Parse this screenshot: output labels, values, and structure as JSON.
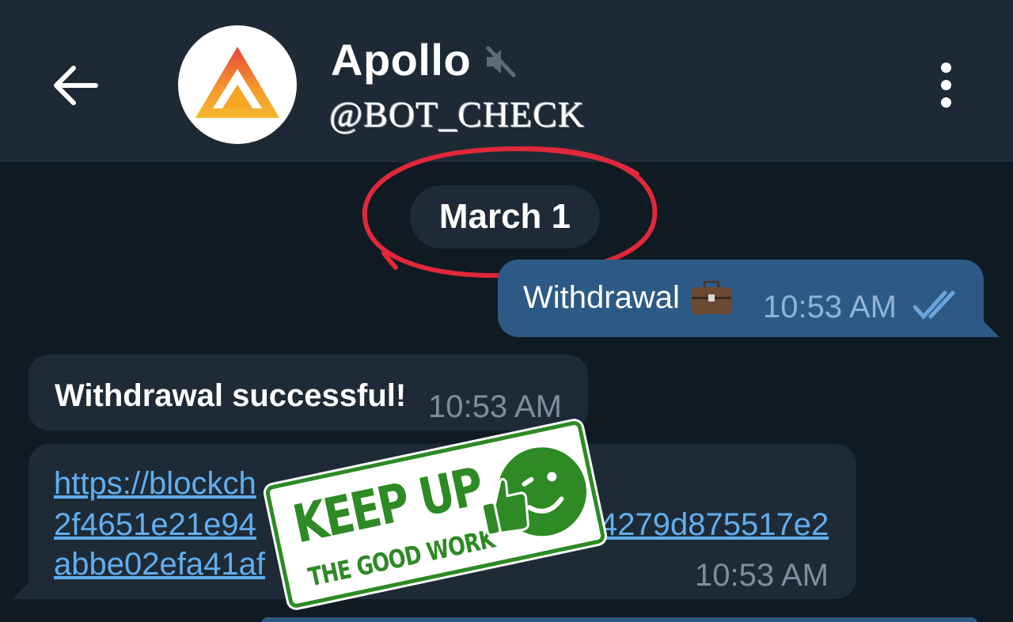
{
  "header": {
    "title": "Apollo",
    "subtitle": "@BOT_CHECK",
    "icons": [
      "back-arrow-icon",
      "bot-avatar-logo",
      "muted-speaker-icon",
      "more-vertical-icon"
    ]
  },
  "date_divider": {
    "label": "March 1"
  },
  "messages": {
    "outgoing": {
      "text": "Withdrawal",
      "emoji": "briefcase",
      "time": "10:53 AM",
      "status": "read"
    },
    "incoming_1": {
      "text": "Withdrawal successful!",
      "time": "10:53 AM"
    },
    "incoming_2": {
      "link_line_1": "https://blockch",
      "link_line_2": "2f4651e21e94",
      "link_line_2_end": "4279d875517e2",
      "link_line_3": "abbe02efa41af",
      "time": "10:53 AM"
    }
  },
  "sticker": {
    "line_1": "KEEP UP",
    "line_2": "THE GOOD WORK"
  },
  "colors": {
    "background": "#0f1a23",
    "header": "#1d2a35",
    "outgoing_bubble": "#2d5a84",
    "incoming_bubble": "#1e2b36",
    "link": "#62aef0",
    "annotation_circle": "#e0283a",
    "sticker_green": "#2d8a24"
  }
}
